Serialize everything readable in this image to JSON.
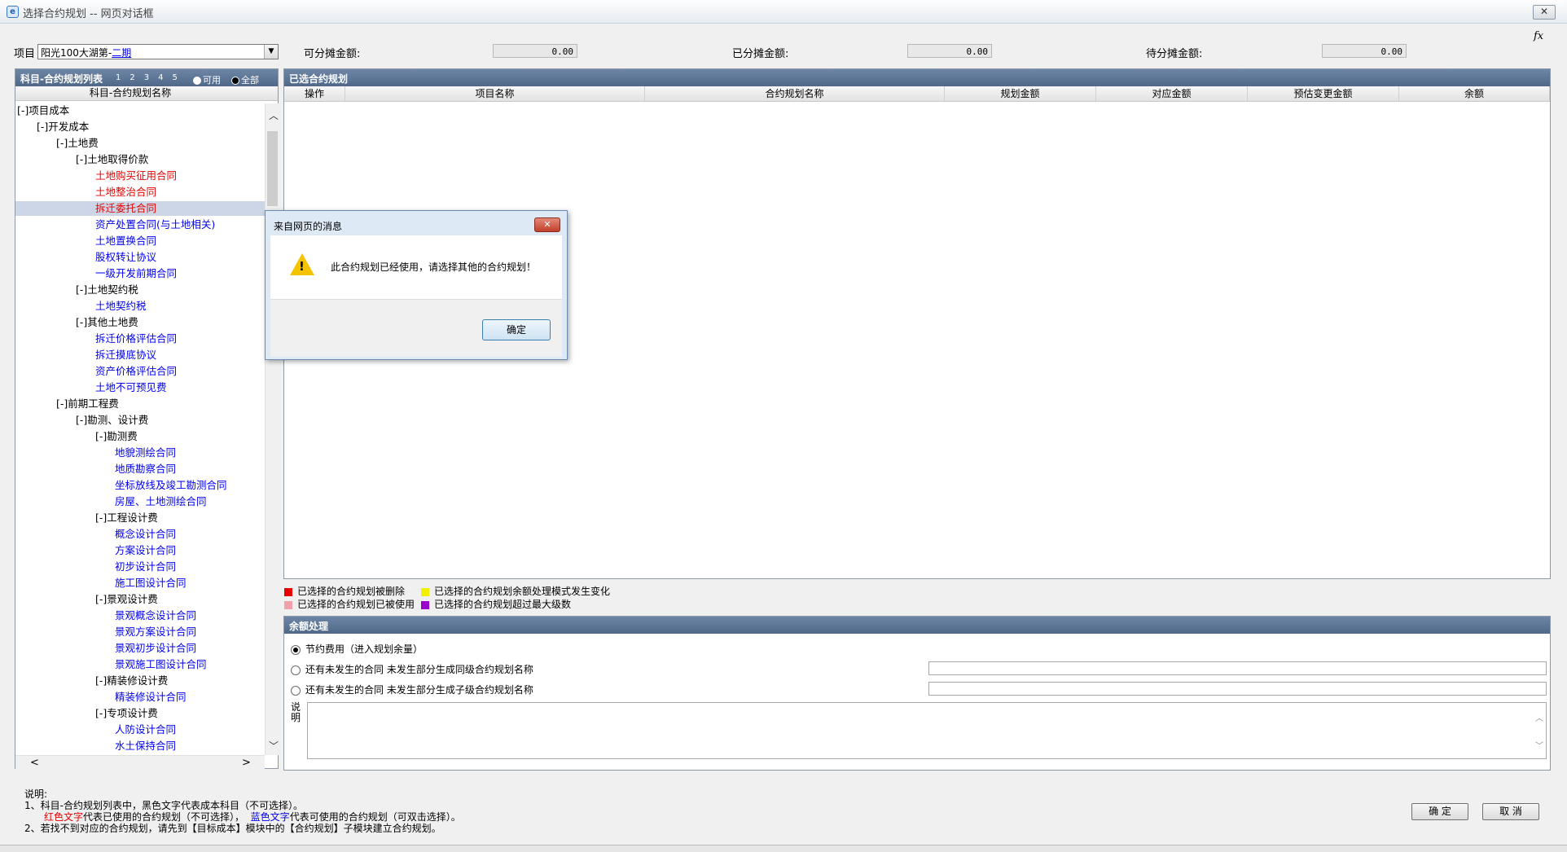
{
  "window": {
    "title": "选择合约规划 -- 网页对话框",
    "close_label": "✕"
  },
  "fx_label": "fx",
  "top": {
    "project_label": "项目",
    "project_value_prefix": "阳光100大湖第-",
    "project_value_link": "二期",
    "available_label": "可分摊金额:",
    "available_value": "0.00",
    "allocated_label": "已分摊金额:",
    "allocated_value": "0.00",
    "pending_label": "待分摊金额:",
    "pending_value": "0.00"
  },
  "left": {
    "title": "科目-合约规划列表",
    "pages": [
      "1",
      "2",
      "3",
      "4",
      "5"
    ],
    "radio_available": "可用",
    "radio_all": "全部",
    "column": "科目-合约规划名称",
    "tree": [
      {
        "label": "[-]项目成本",
        "level": 0,
        "color": "black"
      },
      {
        "label": "[-]开发成本",
        "level": 1,
        "color": "black"
      },
      {
        "label": "[-]土地费",
        "level": 2,
        "color": "black"
      },
      {
        "label": "[-]土地取得价款",
        "level": 3,
        "color": "black"
      },
      {
        "label": "土地购买征用合同",
        "level": 4,
        "color": "red"
      },
      {
        "label": "土地整治合同",
        "level": 4,
        "color": "red"
      },
      {
        "label": "拆迁委托合同",
        "level": 4,
        "color": "red",
        "selected": true
      },
      {
        "label": "资产处置合同(与土地相关)",
        "level": 4,
        "color": "blue"
      },
      {
        "label": "土地置换合同",
        "level": 4,
        "color": "blue"
      },
      {
        "label": "股权转让协议",
        "level": 4,
        "color": "blue"
      },
      {
        "label": "一级开发前期合同",
        "level": 4,
        "color": "blue"
      },
      {
        "label": "[-]土地契约税",
        "level": 3,
        "color": "black"
      },
      {
        "label": "土地契约税",
        "level": 4,
        "color": "blue"
      },
      {
        "label": "[-]其他土地费",
        "level": 3,
        "color": "black"
      },
      {
        "label": "拆迁价格评估合同",
        "level": 4,
        "color": "blue"
      },
      {
        "label": "拆迁摸底协议",
        "level": 4,
        "color": "blue"
      },
      {
        "label": "资产价格评估合同",
        "level": 4,
        "color": "blue"
      },
      {
        "label": "土地不可预见费",
        "level": 4,
        "color": "blue"
      },
      {
        "label": "[-]前期工程费",
        "level": 2,
        "color": "black"
      },
      {
        "label": "[-]勘测、设计费",
        "level": 3,
        "color": "black"
      },
      {
        "label": "[-]勘测费",
        "level": 4,
        "color": "black"
      },
      {
        "label": "地貌测绘合同",
        "level": 5,
        "color": "blue"
      },
      {
        "label": "地质勘察合同",
        "level": 5,
        "color": "blue"
      },
      {
        "label": "坐标放线及竣工勘测合同",
        "level": 5,
        "color": "blue"
      },
      {
        "label": "房屋、土地测绘合同",
        "level": 5,
        "color": "blue"
      },
      {
        "label": "[-]工程设计费",
        "level": 4,
        "color": "black"
      },
      {
        "label": "概念设计合同",
        "level": 5,
        "color": "blue"
      },
      {
        "label": "方案设计合同",
        "level": 5,
        "color": "blue"
      },
      {
        "label": "初步设计合同",
        "level": 5,
        "color": "blue"
      },
      {
        "label": "施工图设计合同",
        "level": 5,
        "color": "blue"
      },
      {
        "label": "[-]景观设计费",
        "level": 4,
        "color": "black"
      },
      {
        "label": "景观概念设计合同",
        "level": 5,
        "color": "blue"
      },
      {
        "label": "景观方案设计合同",
        "level": 5,
        "color": "blue"
      },
      {
        "label": "景观初步设计合同",
        "level": 5,
        "color": "blue"
      },
      {
        "label": "景观施工图设计合同",
        "level": 5,
        "color": "blue"
      },
      {
        "label": "[-]精装修设计费",
        "level": 4,
        "color": "black"
      },
      {
        "label": "精装修设计合同",
        "level": 5,
        "color": "blue"
      },
      {
        "label": "[-]专项设计费",
        "level": 4,
        "color": "black"
      },
      {
        "label": "人防设计合同",
        "level": 5,
        "color": "blue"
      },
      {
        "label": "水土保持合同",
        "level": 5,
        "color": "blue"
      }
    ]
  },
  "selected": {
    "title": "已选合约规划",
    "columns": [
      "操作",
      "项目名称",
      "合约规划名称",
      "规划金额",
      "对应金额",
      "预估变更金额",
      "余额"
    ]
  },
  "legend": [
    {
      "color": "#e60000",
      "text": "已选择的合约规划被删除"
    },
    {
      "color": "#f0f000",
      "text": "已选择的合约规划余额处理模式发生变化"
    },
    {
      "color": "#f0a0a8",
      "text": "已选择的合约规划已被使用"
    },
    {
      "color": "#9a00cc",
      "text": "已选择的合约规划超过最大级数"
    }
  ],
  "surplus": {
    "title": "余额处理",
    "option1": "节约费用（进入规划余量）",
    "option2": "还有未发生的合同 未发生部分生成同级合约规划名称",
    "option3": "还有未发生的合同 未发生部分生成子级合约规划名称",
    "note_label": "说明"
  },
  "bottom": {
    "heading": "说明:",
    "line1": "1、科目-合约规划列表中，黑色文字代表成本科目（不可选择）。",
    "line2_red": "红色文字",
    "line2_mid": "代表已使用的合约规划（不可选择），",
    "line2_blue": "蓝色文字",
    "line2_end": "代表可使用的合约规划（可双击选择）。",
    "line3": "2、若找不到对应的合约规划，请先到【目标成本】模块中的【合约规划】子模块建立合约规划。",
    "ok": "确 定",
    "cancel": "取 消"
  },
  "dialog": {
    "title": "来自网页的消息",
    "close": "✕",
    "message": "此合约规划已经使用，请选择其他的合约规划！",
    "ok": "确定"
  }
}
